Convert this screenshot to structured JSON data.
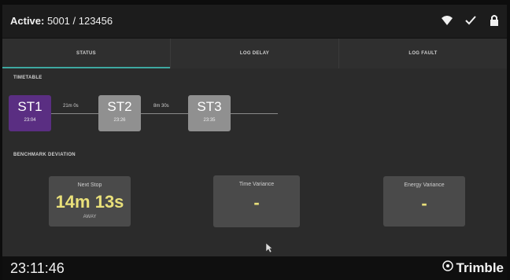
{
  "header": {
    "title_prefix": "Active:",
    "title_value": "5001 / 123456",
    "icons": [
      "wifi-icon",
      "check-icon",
      "lock-icon"
    ]
  },
  "tabs": [
    {
      "label": "STATUS",
      "active": true
    },
    {
      "label": "LOG DELAY",
      "active": false
    },
    {
      "label": "LOG FAULT",
      "active": false
    }
  ],
  "timetable": {
    "label": "TIMETABLE",
    "stops": [
      {
        "code": "ST1",
        "time": "23:04",
        "current": true
      },
      {
        "code": "ST2",
        "time": "23:26",
        "current": false
      },
      {
        "code": "ST3",
        "time": "23:35",
        "current": false
      }
    ],
    "segments": [
      "21m 0s",
      "8m 30s"
    ]
  },
  "benchmark": {
    "label": "BENCHMARK DEVIATION",
    "cards": [
      {
        "label": "Next Stop",
        "value": "14m 13s",
        "sub": "AWAY"
      },
      {
        "label": "Time Variance",
        "value": "-",
        "sub": ""
      },
      {
        "label": "Energy Variance",
        "value": "-",
        "sub": ""
      }
    ]
  },
  "footer": {
    "clock": "23:11:46",
    "brand": "Trimble"
  },
  "colors": {
    "current_stop": "#5a2e82",
    "accent": "#3ea8a0",
    "value_text": "#e9e07a"
  }
}
